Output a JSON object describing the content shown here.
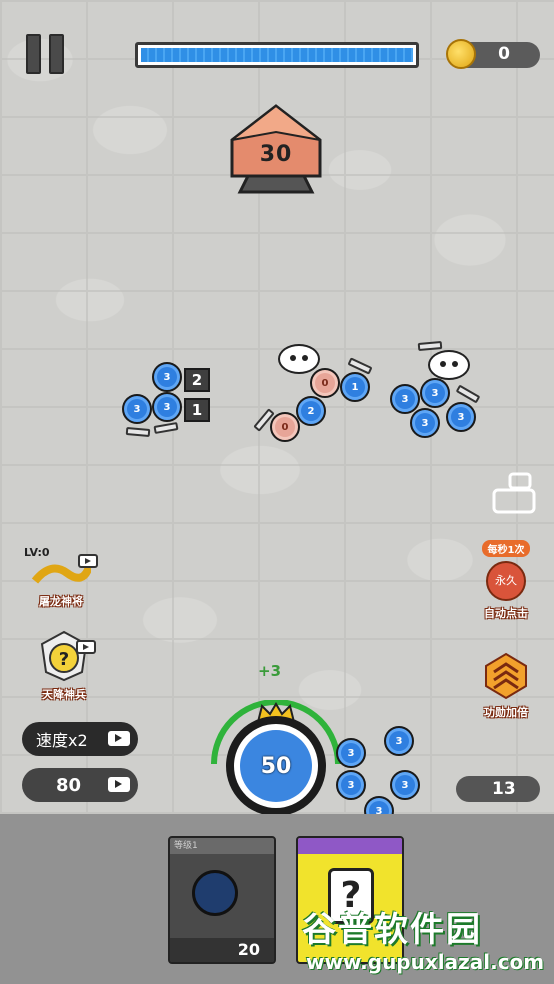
{
  "hud": {
    "coins": "0",
    "progress": 1.0
  },
  "enemy_base": {
    "level": "30"
  },
  "units_left": [
    {
      "label": "3"
    },
    {
      "label": "3"
    },
    {
      "label": "3"
    }
  ],
  "tower_tags": [
    "2",
    "1"
  ],
  "units_middle": [
    {
      "label": "0",
      "red": true
    },
    {
      "label": "2",
      "red": false
    },
    {
      "label": "0",
      "red": true
    },
    {
      "label": "1",
      "red": false
    }
  ],
  "units_right": [
    {
      "label": "3"
    },
    {
      "label": "3"
    },
    {
      "label": "3"
    },
    {
      "label": "3"
    },
    {
      "label": "3"
    }
  ],
  "abilities": {
    "dragon": {
      "level": "LV:0",
      "label": "屠龙神将"
    },
    "soldier": {
      "label": "天降神兵"
    },
    "auto_click": {
      "badge": "每秒1次",
      "label": "自动点击",
      "seal": "永久"
    },
    "merit": {
      "label": "功勋加倍"
    }
  },
  "speed_button": {
    "label": "速度x2"
  },
  "gem_counter": {
    "value": "80"
  },
  "bonus": {
    "text": "+3"
  },
  "main_button": {
    "value": "50"
  },
  "rank_counter": {
    "value": "13"
  },
  "bottom_units": [
    "3",
    "3",
    "3",
    "3",
    "3"
  ],
  "cards": {
    "unit": {
      "header": "等级1",
      "cost": "20"
    },
    "mystery": {
      "header": "",
      "glyph": "?"
    }
  },
  "watermark": {
    "title": "谷普软件园",
    "url": "www.gupuxlazal.com"
  }
}
